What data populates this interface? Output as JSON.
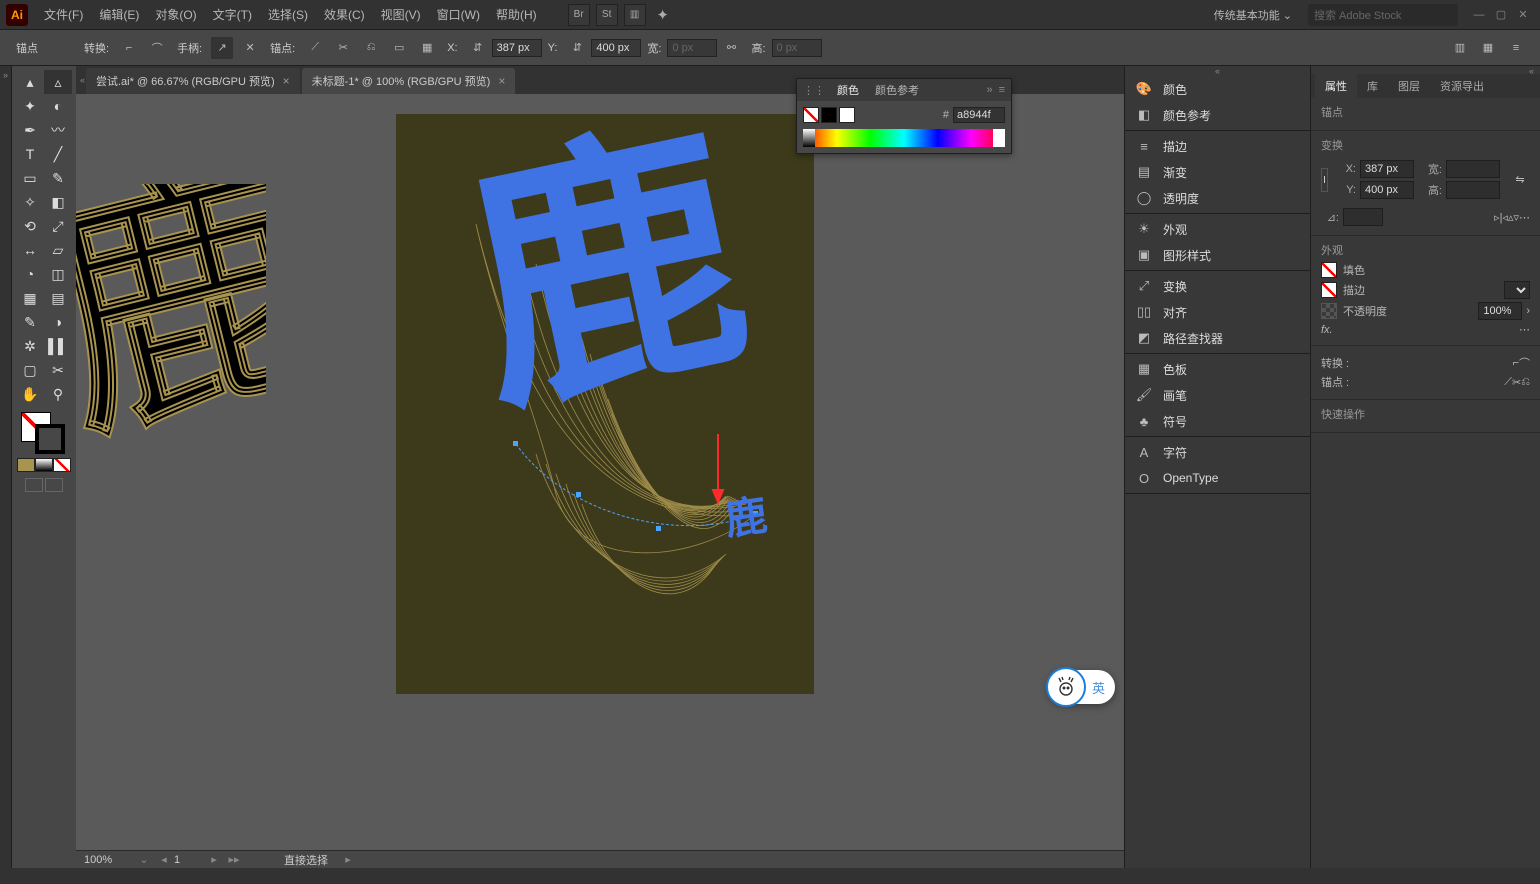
{
  "app": {
    "logo": "Ai"
  },
  "menu": {
    "file": "文件(F)",
    "edit": "编辑(E)",
    "object": "对象(O)",
    "type": "文字(T)",
    "select": "选择(S)",
    "effect": "效果(C)",
    "view": "视图(V)",
    "window": "窗口(W)",
    "help": "帮助(H)"
  },
  "topright": {
    "br": "Br",
    "st": "St",
    "workspace": "传统基本功能",
    "search_placeholder": "搜索 Adobe Stock"
  },
  "control": {
    "anchor_label": "锚点",
    "convert_label": "转换:",
    "handle_label": "手柄:",
    "anchor2_label": "锚点:",
    "x_label": "X:",
    "x_value": "387 px",
    "y_label": "Y:",
    "y_value": "400 px",
    "w_label": "宽:",
    "w_value": "0 px",
    "h_label": "高:",
    "h_value": "0 px"
  },
  "tabs": {
    "tab1": "尝试.ai* @ 66.67% (RGB/GPU 预览)",
    "tab2": "未标题-1* @ 100% (RGB/GPU 预览)"
  },
  "color_panel": {
    "title1": "颜色",
    "title2": "颜色参考",
    "hash": "#",
    "hex": "a8944f"
  },
  "midpanels": {
    "color": "颜色",
    "colorguide": "颜色参考",
    "stroke": "描边",
    "gradient": "渐变",
    "transparency": "透明度",
    "appearance": "外观",
    "graphicstyles": "图形样式",
    "transform": "变换",
    "align": "对齐",
    "pathfinder": "路径查找器",
    "swatches": "色板",
    "brushes": "画笔",
    "symbols": "符号",
    "character": "字符",
    "opentype": "OpenType"
  },
  "rightpanel": {
    "tab_props": "属性",
    "tab_lib": "库",
    "tab_layers": "图层",
    "tab_assets": "资源导出",
    "sec_anchor": "锚点",
    "sec_transform": "变换",
    "x_label": "X:",
    "x_value": "387 px",
    "y_label": "Y:",
    "y_value": "400 px",
    "w_label": "宽:",
    "w_value": "",
    "h_label": "高:",
    "h_value": "",
    "angle_label": "⊿:",
    "sec_appearance": "外观",
    "fill_label": "填色",
    "stroke_label": "描边",
    "opacity_label": "不透明度",
    "opacity_value": "100%",
    "fx_label": "fx.",
    "convert_label": "转换 :",
    "anchor_label": "锚点 :",
    "quick_label": "快速操作"
  },
  "status": {
    "zoom": "100%",
    "artboard_num": "1",
    "tool": "直接选择"
  },
  "ime": {
    "lang": "英"
  }
}
